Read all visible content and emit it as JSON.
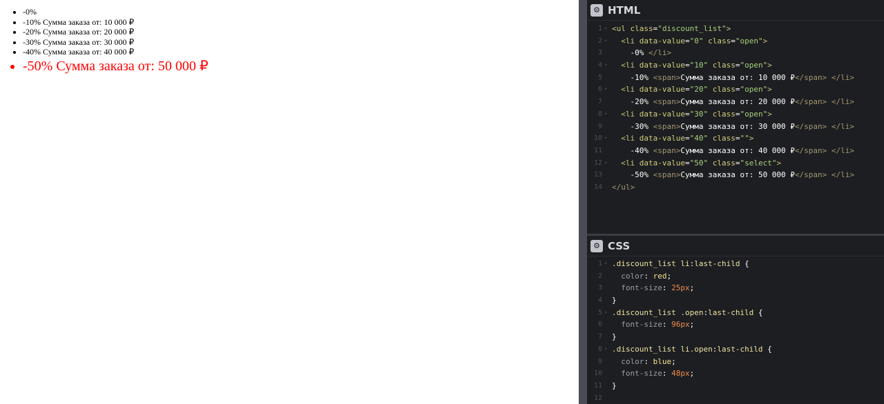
{
  "preview": {
    "items": [
      "-0%",
      "-10% Сумма заказа от: 10 000 ₽",
      "-20% Сумма заказа от: 20 000 ₽",
      "-30% Сумма заказа от: 30 000 ₽",
      "-40% Сумма заказа от: 40 000 ₽",
      "-50% Сумма заказа от: 50 000 ₽"
    ],
    "last_item_color": "#ff0000"
  },
  "html_panel": {
    "title": "HTML",
    "icon": "gear-icon",
    "lines": [
      {
        "n": "1",
        "parts": [
          [
            "tag",
            "<ul "
          ],
          [
            "attr",
            "class"
          ],
          [
            "punc",
            "="
          ],
          [
            "val",
            "\"discount_list\""
          ],
          [
            "tag",
            ">"
          ]
        ]
      },
      {
        "n": "2",
        "parts": [
          [
            "text",
            "  "
          ],
          [
            "tag",
            "<li "
          ],
          [
            "attr",
            "data-value"
          ],
          [
            "punc",
            "="
          ],
          [
            "val",
            "\"0\""
          ],
          [
            "text",
            " "
          ],
          [
            "attr",
            "class"
          ],
          [
            "punc",
            "="
          ],
          [
            "val",
            "\"open\""
          ],
          [
            "tag",
            ">"
          ]
        ]
      },
      {
        "n": "3",
        "parts": [
          [
            "text",
            "    -0% "
          ],
          [
            "close",
            "</li>"
          ]
        ]
      },
      {
        "n": "4",
        "parts": [
          [
            "text",
            "  "
          ],
          [
            "tag",
            "<li "
          ],
          [
            "attr",
            "data-value"
          ],
          [
            "punc",
            "="
          ],
          [
            "val",
            "\"10\""
          ],
          [
            "text",
            " "
          ],
          [
            "attr",
            "class"
          ],
          [
            "punc",
            "="
          ],
          [
            "val",
            "\"open\""
          ],
          [
            "tag",
            ">"
          ]
        ]
      },
      {
        "n": "5",
        "parts": [
          [
            "text",
            "    -10% "
          ],
          [
            "close",
            "<span>"
          ],
          [
            "text",
            "Сумма заказа от: 10 000 ₽"
          ],
          [
            "close",
            "</span>"
          ],
          [
            "text",
            " "
          ],
          [
            "close",
            "</li>"
          ]
        ]
      },
      {
        "n": "6",
        "parts": [
          [
            "text",
            "  "
          ],
          [
            "tag",
            "<li "
          ],
          [
            "attr",
            "data-value"
          ],
          [
            "punc",
            "="
          ],
          [
            "val",
            "\"20\""
          ],
          [
            "text",
            " "
          ],
          [
            "attr",
            "class"
          ],
          [
            "punc",
            "="
          ],
          [
            "val",
            "\"open\""
          ],
          [
            "tag",
            ">"
          ]
        ]
      },
      {
        "n": "7",
        "parts": [
          [
            "text",
            "    -20% "
          ],
          [
            "close",
            "<span>"
          ],
          [
            "text",
            "Сумма заказа от: 20 000 ₽"
          ],
          [
            "close",
            "</span>"
          ],
          [
            "text",
            " "
          ],
          [
            "close",
            "</li>"
          ]
        ]
      },
      {
        "n": "8",
        "parts": [
          [
            "text",
            "  "
          ],
          [
            "tag",
            "<li "
          ],
          [
            "attr",
            "data-value"
          ],
          [
            "punc",
            "="
          ],
          [
            "val",
            "\"30\""
          ],
          [
            "text",
            " "
          ],
          [
            "attr",
            "class"
          ],
          [
            "punc",
            "="
          ],
          [
            "val",
            "\"open\""
          ],
          [
            "tag",
            ">"
          ]
        ]
      },
      {
        "n": "9",
        "parts": [
          [
            "text",
            "    -30% "
          ],
          [
            "close",
            "<span>"
          ],
          [
            "text",
            "Сумма заказа от: 30 000 ₽"
          ],
          [
            "close",
            "</span>"
          ],
          [
            "text",
            " "
          ],
          [
            "close",
            "</li>"
          ]
        ]
      },
      {
        "n": "10",
        "parts": [
          [
            "text",
            "  "
          ],
          [
            "tag",
            "<li "
          ],
          [
            "attr",
            "data-value"
          ],
          [
            "punc",
            "="
          ],
          [
            "val",
            "\"40\""
          ],
          [
            "text",
            " "
          ],
          [
            "attr",
            "class"
          ],
          [
            "punc",
            "="
          ],
          [
            "val",
            "\"\""
          ],
          [
            "tag",
            ">"
          ]
        ]
      },
      {
        "n": "11",
        "parts": [
          [
            "text",
            "    -40% "
          ],
          [
            "close",
            "<span>"
          ],
          [
            "text",
            "Сумма заказа от: 40 000 ₽"
          ],
          [
            "close",
            "</span>"
          ],
          [
            "text",
            " "
          ],
          [
            "close",
            "</li>"
          ]
        ]
      },
      {
        "n": "12",
        "parts": [
          [
            "text",
            "  "
          ],
          [
            "tag",
            "<li "
          ],
          [
            "attr",
            "data-value"
          ],
          [
            "punc",
            "="
          ],
          [
            "val",
            "\"50\""
          ],
          [
            "text",
            " "
          ],
          [
            "attr",
            "class"
          ],
          [
            "punc",
            "="
          ],
          [
            "val",
            "\"select\""
          ],
          [
            "tag",
            ">"
          ]
        ]
      },
      {
        "n": "13",
        "parts": [
          [
            "text",
            "    -50% "
          ],
          [
            "close",
            "<span>"
          ],
          [
            "text",
            "Сумма заказа от: 50 000 ₽"
          ],
          [
            "close",
            "</span>"
          ],
          [
            "text",
            " "
          ],
          [
            "close",
            "</li>"
          ]
        ]
      },
      {
        "n": "14",
        "parts": [
          [
            "close",
            "</ul>"
          ]
        ]
      }
    ]
  },
  "css_panel": {
    "title": "CSS",
    "icon": "gear-icon",
    "lines": [
      {
        "n": "1",
        "parts": [
          [
            "sel",
            ".discount_list li"
          ],
          [
            "punc",
            ":"
          ],
          [
            "sel",
            "last-child"
          ],
          [
            "punc",
            " {"
          ]
        ]
      },
      {
        "n": "2",
        "parts": [
          [
            "text",
            "  "
          ],
          [
            "prop",
            "color"
          ],
          [
            "punc",
            ": "
          ],
          [
            "kw",
            "red"
          ],
          [
            "punc",
            ";"
          ]
        ]
      },
      {
        "n": "3",
        "parts": [
          [
            "text",
            "  "
          ],
          [
            "prop",
            "font-size"
          ],
          [
            "punc",
            ": "
          ],
          [
            "num",
            "25px"
          ],
          [
            "punc",
            ";"
          ]
        ]
      },
      {
        "n": "4",
        "parts": [
          [
            "punc",
            "}"
          ]
        ]
      },
      {
        "n": "5",
        "parts": [
          [
            "sel",
            ".discount_list .open"
          ],
          [
            "punc",
            ":"
          ],
          [
            "sel",
            "last-child"
          ],
          [
            "punc",
            " {"
          ]
        ]
      },
      {
        "n": "6",
        "parts": [
          [
            "text",
            "  "
          ],
          [
            "prop",
            "font-size"
          ],
          [
            "punc",
            ": "
          ],
          [
            "num",
            "96px"
          ],
          [
            "punc",
            ";"
          ]
        ]
      },
      {
        "n": "7",
        "parts": [
          [
            "punc",
            "}"
          ]
        ]
      },
      {
        "n": "8",
        "parts": [
          [
            "sel",
            ".discount_list li.open"
          ],
          [
            "punc",
            ":"
          ],
          [
            "sel",
            "last-child"
          ],
          [
            "punc",
            " {"
          ]
        ]
      },
      {
        "n": "9",
        "parts": [
          [
            "text",
            "  "
          ],
          [
            "prop",
            "color"
          ],
          [
            "punc",
            ": "
          ],
          [
            "kw",
            "blue"
          ],
          [
            "punc",
            ";"
          ]
        ]
      },
      {
        "n": "10",
        "parts": [
          [
            "text",
            "  "
          ],
          [
            "prop",
            "font-size"
          ],
          [
            "punc",
            ": "
          ],
          [
            "num",
            "48px"
          ],
          [
            "punc",
            ";"
          ]
        ]
      },
      {
        "n": "11",
        "parts": [
          [
            "punc",
            "}"
          ]
        ]
      },
      {
        "n": "12",
        "parts": []
      }
    ]
  }
}
